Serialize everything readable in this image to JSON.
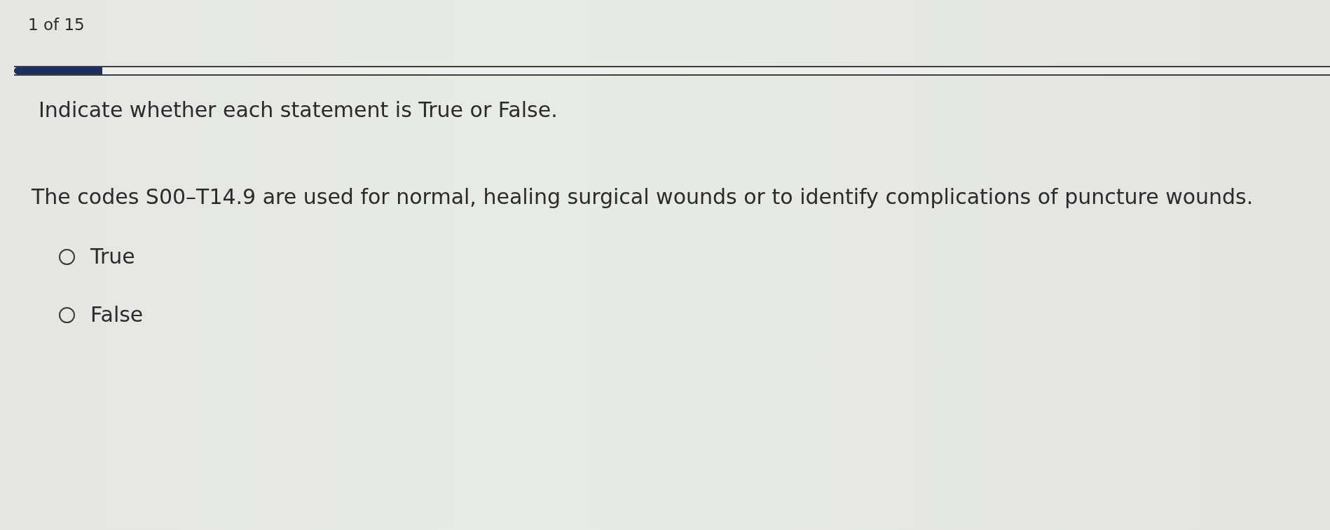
{
  "counter": "1 of 15",
  "progress": {
    "level": 0.067
  },
  "instruction": "Indicate whether each statement is True or False.",
  "question": {
    "text": "The codes S00–T14.9 are used for normal, healing surgical wounds or to identify complications of puncture wounds.",
    "options": [
      {
        "label": "True",
        "selected": false
      },
      {
        "label": "False",
        "selected": false
      }
    ]
  }
}
